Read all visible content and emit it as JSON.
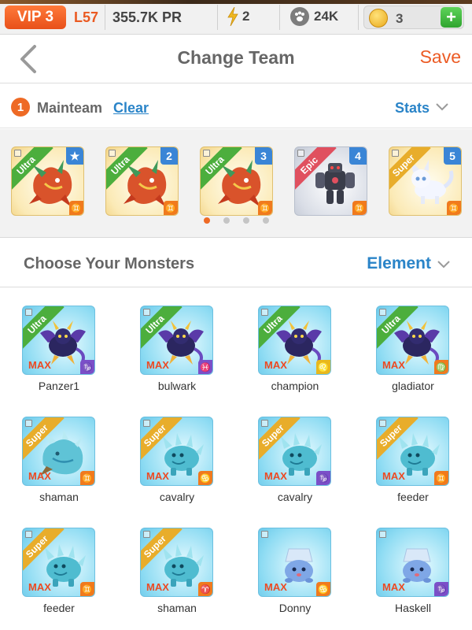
{
  "topbar": {
    "vip": "VIP 3",
    "level": "L57",
    "pr": "355.7K PR",
    "energy": "2",
    "food": "24K",
    "coins": "3",
    "add_label": "+"
  },
  "header": {
    "title": "Change Team",
    "save_label": "Save"
  },
  "team": {
    "number": "1",
    "name": "Mainteam",
    "clear_label": "Clear",
    "stats_label": "Stats",
    "slots": [
      {
        "rarity": "Ultra",
        "badge": "★",
        "art": "dragon"
      },
      {
        "rarity": "Ultra",
        "badge": "2",
        "art": "dragon"
      },
      {
        "rarity": "Ultra",
        "badge": "3",
        "art": "dragon"
      },
      {
        "rarity": "Epic",
        "badge": "4",
        "art": "robot"
      },
      {
        "rarity": "Super",
        "badge": "5",
        "art": "cat"
      }
    ],
    "page_dots": 4,
    "active_dot": 0
  },
  "choose": {
    "title": "Choose Your Monsters",
    "filter_label": "Element"
  },
  "monsters": [
    {
      "name": "Panzer1",
      "rarity": "Ultra",
      "level": "MAX",
      "sign": "♑",
      "element": "purple",
      "art": "darkdragon"
    },
    {
      "name": "bulwark",
      "rarity": "Ultra",
      "level": "MAX",
      "sign": "♓",
      "element": "purple",
      "art": "darkdragon"
    },
    {
      "name": "champion",
      "rarity": "Ultra",
      "level": "MAX",
      "sign": "♌",
      "element": "yellow",
      "art": "darkdragon"
    },
    {
      "name": "gladiator",
      "rarity": "Ultra",
      "level": "MAX",
      "sign": "♍",
      "element": "orange",
      "art": "darkdragon"
    },
    {
      "name": "shaman",
      "rarity": "Super",
      "level": "MAX",
      "sign": "♊",
      "element": "orange",
      "art": "icedragon"
    },
    {
      "name": "cavalry",
      "rarity": "Super",
      "level": "MAX",
      "sign": "♋",
      "element": "orange",
      "art": "icebeast"
    },
    {
      "name": "cavalry",
      "rarity": "Super",
      "level": "MAX",
      "sign": "♑",
      "element": "purple",
      "art": "icebeast"
    },
    {
      "name": "feeder",
      "rarity": "Super",
      "level": "MAX",
      "sign": "♊",
      "element": "orange",
      "art": "icebeast"
    },
    {
      "name": "feeder",
      "rarity": "Super",
      "level": "MAX",
      "sign": "♊",
      "element": "orange",
      "art": "icebeast"
    },
    {
      "name": "shaman",
      "rarity": "Super",
      "level": "MAX",
      "sign": "♈",
      "element": "orange",
      "art": "icebeast"
    },
    {
      "name": "Donny",
      "rarity": "",
      "level": "MAX",
      "sign": "♋",
      "element": "orange",
      "art": "blob"
    },
    {
      "name": "Haskell",
      "rarity": "",
      "level": "MAX",
      "sign": "♑",
      "element": "purple",
      "art": "blob"
    }
  ]
}
